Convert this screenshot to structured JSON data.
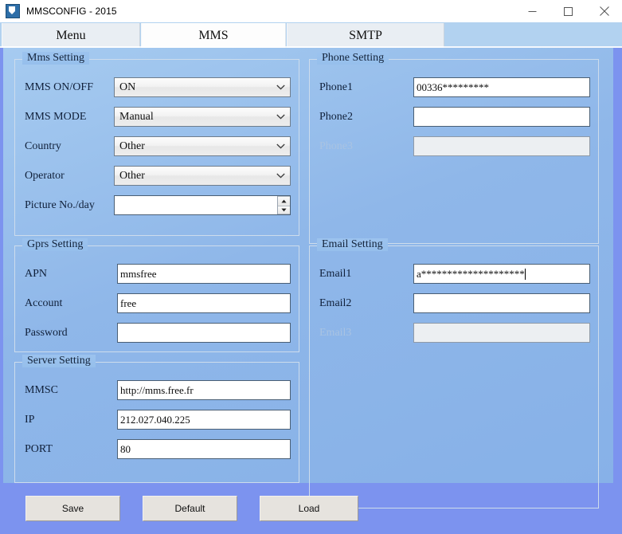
{
  "window": {
    "title": "MMSCONFIG - 2015",
    "icon": "app-icon",
    "controls": {
      "minimize": "minimize-icon",
      "maximize": "maximize-icon",
      "close": "close-icon"
    }
  },
  "tabs": [
    {
      "label": "Menu",
      "active": false
    },
    {
      "label": "MMS",
      "active": true
    },
    {
      "label": "SMTP",
      "active": false
    }
  ],
  "groups": {
    "mms": {
      "legend": "Mms Setting",
      "fields": [
        {
          "label": "MMS ON/OFF",
          "type": "combo",
          "value": "ON"
        },
        {
          "label": "MMS MODE",
          "type": "combo",
          "value": "Manual"
        },
        {
          "label": "Country",
          "type": "combo",
          "value": "Other"
        },
        {
          "label": "Operator",
          "type": "combo",
          "value": "Other"
        },
        {
          "label": "Picture No./day",
          "type": "spinner",
          "value": ""
        }
      ]
    },
    "phone": {
      "legend": "Phone Setting",
      "fields": [
        {
          "label": "Phone1",
          "type": "text",
          "value": "00336*********",
          "disabled": false
        },
        {
          "label": "Phone2",
          "type": "text",
          "value": "",
          "disabled": false
        },
        {
          "label": "Phone3",
          "type": "text",
          "value": "",
          "disabled": true
        }
      ]
    },
    "gprs": {
      "legend": "Gprs Setting",
      "fields": [
        {
          "label": "APN",
          "type": "text",
          "value": "mmsfree",
          "disabled": false
        },
        {
          "label": "Account",
          "type": "text",
          "value": "free",
          "disabled": false
        },
        {
          "label": "Password",
          "type": "text",
          "value": "",
          "disabled": false
        }
      ]
    },
    "email": {
      "legend": "Email Setting",
      "fields": [
        {
          "label": "Email1",
          "type": "text",
          "value": "a********************",
          "disabled": false,
          "focused": true
        },
        {
          "label": "Email2",
          "type": "text",
          "value": "",
          "disabled": false
        },
        {
          "label": "Email3",
          "type": "text",
          "value": "",
          "disabled": true
        }
      ]
    },
    "server": {
      "legend": "Server Setting",
      "fields": [
        {
          "label": "MMSC",
          "type": "text",
          "value": "http://mms.free.fr",
          "disabled": false
        },
        {
          "label": "IP",
          "type": "text",
          "value": "212.027.040.225",
          "disabled": false
        },
        {
          "label": "PORT",
          "type": "text",
          "value": "80",
          "disabled": false
        }
      ]
    }
  },
  "buttons": {
    "save": "Save",
    "default": "Default",
    "load": "Load"
  },
  "colors": {
    "window_background": "#7c93ef",
    "panel_blue": "#8fb7e9",
    "tabstrip_blue": "#b2d2f0",
    "active_tab": "#fdfdfd",
    "inactive_tab": "#e9eef3",
    "button_face": "#e6e3de",
    "disabled_field": "#eceff2",
    "disabled_label": "#a9c3e2"
  }
}
